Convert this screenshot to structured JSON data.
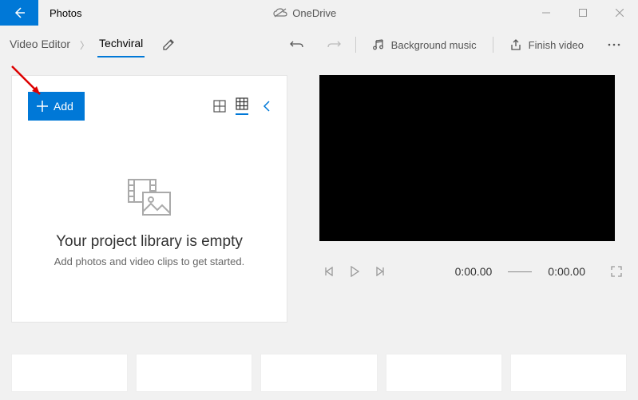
{
  "titlebar": {
    "app_title": "Photos",
    "cloud_label": "OneDrive"
  },
  "toolbar": {
    "crumb1": "Video Editor",
    "crumb2": "Techviral",
    "bg_music": "Background music",
    "finish": "Finish video"
  },
  "library": {
    "add_label": "Add",
    "empty_title": "Your project library is empty",
    "empty_sub": "Add photos and video clips to get started."
  },
  "playback": {
    "time_current": "0:00.00",
    "time_total": "0:00.00"
  }
}
